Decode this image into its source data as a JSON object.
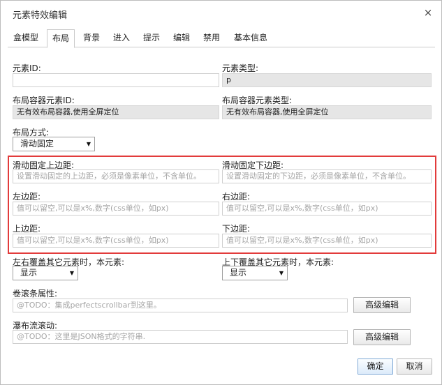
{
  "dialog": {
    "title": "元素特效编辑",
    "close_icon": "×"
  },
  "tabs": [
    {
      "label": "盒模型"
    },
    {
      "label": "布局"
    },
    {
      "label": "背景"
    },
    {
      "label": "进入"
    },
    {
      "label": "提示"
    },
    {
      "label": "编辑"
    },
    {
      "label": "禁用"
    },
    {
      "label": "基本信息"
    }
  ],
  "active_tab": "布局",
  "fields": {
    "element_id": {
      "label": "元素ID:",
      "value": ""
    },
    "element_type": {
      "label": "元素类型:",
      "value": "p"
    },
    "container_id": {
      "label": "布局容器元素ID:",
      "value": "无有效布局容器,使用全屏定位"
    },
    "container_type": {
      "label": "布局容器元素类型:",
      "value": "无有效布局容器,使用全屏定位"
    },
    "layout_mode": {
      "label": "布局方式:",
      "value": "滑动固定"
    },
    "sticky_top": {
      "label": "滑动固定上边距:",
      "placeholder": "设置滑动固定的上边距，必须是像素单位，不含单位。"
    },
    "sticky_bottom": {
      "label": "滑动固定下边距:",
      "placeholder": "设置滑动固定的下边距，必须是像素单位，不含单位。"
    },
    "left": {
      "label": "左边距:",
      "placeholder": "值可以留空,可以是x%,数字(css单位，如px)"
    },
    "right": {
      "label": "右边距:",
      "placeholder": "值可以留空,可以是x%,数字(css单位，如px)"
    },
    "top": {
      "label": "上边距:",
      "placeholder": "值可以留空,可以是x%,数字(css单位，如px)"
    },
    "bottom": {
      "label": "下边距:",
      "placeholder": "值可以留空,可以是x%,数字(css单位，如px)"
    },
    "overlay_lr": {
      "label": "左右覆盖其它元素时，本元素:",
      "value": "显示"
    },
    "overlay_tb": {
      "label": "上下覆盖其它元素时，本元素:",
      "value": "显示"
    },
    "scrollbar": {
      "label": "卷滚条属性:",
      "placeholder": "@TODO：集成perfectscrollbar到这里。",
      "button": "高级编辑"
    },
    "waterfall": {
      "label": "瀑布流滚动:",
      "placeholder": "@TODO：这里是JSON格式的字符串.",
      "button": "高级编辑"
    }
  },
  "footer": {
    "ok": "确定",
    "cancel": "取消"
  },
  "colors": {
    "highlight_border": "#e23b3b",
    "readonly_bg": "#e6e6e6"
  }
}
